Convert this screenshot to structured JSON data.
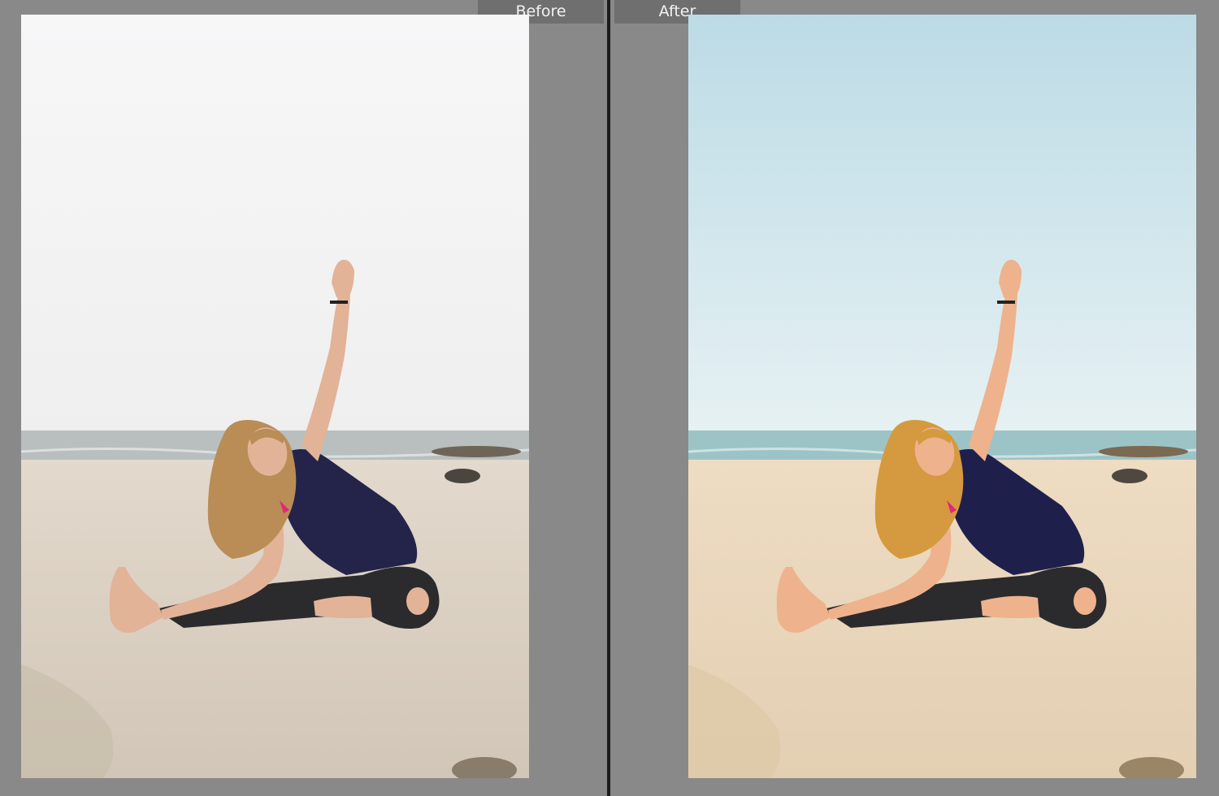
{
  "compare_view": {
    "before": {
      "label": "Before",
      "colors": {
        "sky_top": "#f7f7f8",
        "sky_bottom": "#efefef",
        "sea": "#b8bfbe",
        "sand_top": "#e3d9cc",
        "sand_bottom": "#d1c6b7",
        "hair": "#b98d55",
        "skin": "#e2b397",
        "shirt": "#24244a",
        "leggings": "#2b2b2d"
      }
    },
    "after": {
      "label": "After",
      "colors": {
        "sky_top": "#bcdbe6",
        "sky_bottom": "#e6f1f3",
        "sea": "#9cc4c6",
        "sand_top": "#eedcc3",
        "sand_bottom": "#e3cfb2",
        "hair": "#d59a3f",
        "skin": "#eeb28d",
        "shirt": "#1f1f4c",
        "leggings": "#2b2b2e"
      }
    },
    "divider_color": "#1c1c1c",
    "background_color": "#898989"
  }
}
